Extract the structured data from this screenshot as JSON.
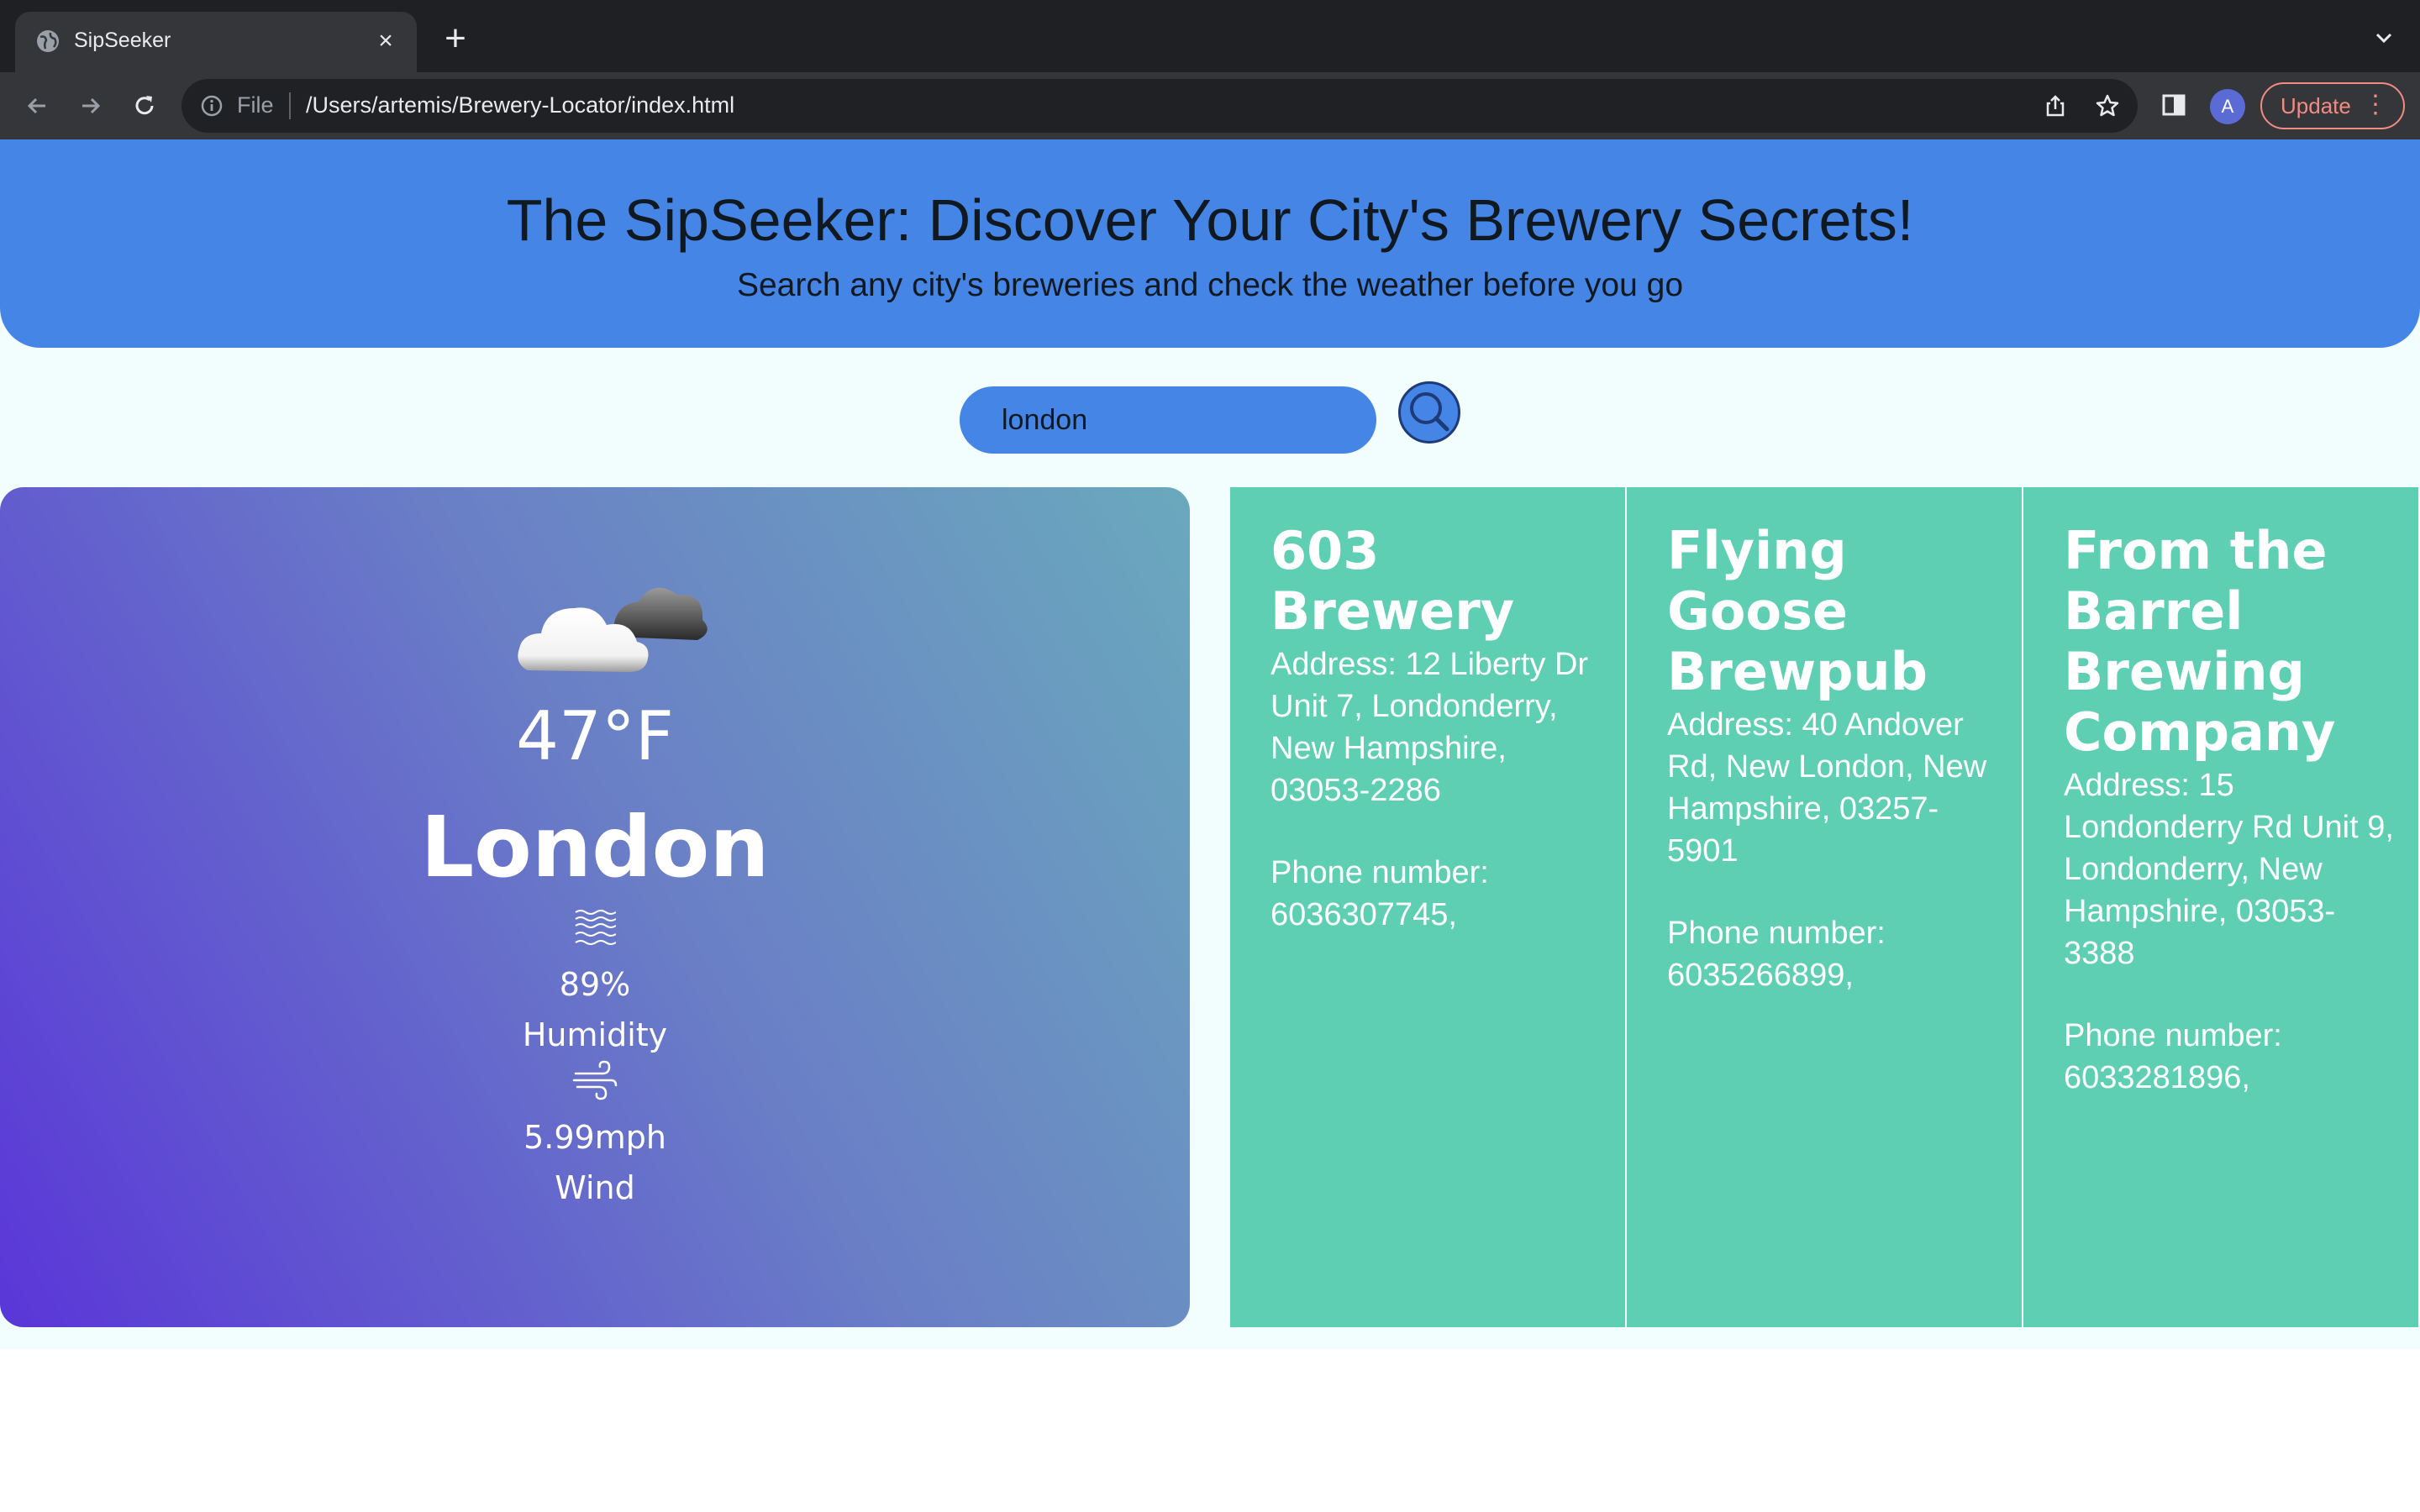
{
  "browser": {
    "tab_title": "SipSeeker",
    "url_scheme": "File",
    "url": "/Users/artemis/Brewery-Locator/index.html",
    "profile_initial": "A",
    "update_label": "Update"
  },
  "header": {
    "title": "The SipSeeker: Discover Your City's Brewery Secrets!",
    "subtitle": "Search any city's breweries and check the weather before you go"
  },
  "search": {
    "value": "london"
  },
  "weather": {
    "icon": "partly-cloudy-icon",
    "temperature": "47°F",
    "city": "London",
    "humidity_value": "89%",
    "humidity_label": "Humidity",
    "wind_value": "5.99mph",
    "wind_label": "Wind"
  },
  "breweries": [
    {
      "name": "603 Brewery",
      "address": "Address: 12 Liberty Dr Unit 7, Londonderry, New Hampshire, 03053-2286",
      "phone_label": "Phone number:",
      "phone": "6036307745,"
    },
    {
      "name": "Flying Goose Brewpub",
      "address": "Address: 40 Andover Rd, New London, New Hampshire, 03257-5901",
      "phone_label": "Phone number:",
      "phone": "6035266899,"
    },
    {
      "name": "From the Barrel Brewing Company",
      "address": "Address: 15 Londonderry Rd Unit 9, Londonderry, New Hampshire, 03053-3388",
      "phone_label": "Phone number:",
      "phone": "6033281896,"
    }
  ],
  "colors": {
    "header_blue": "#4585e6",
    "brewery_card": "#5fcfb3",
    "page_bg": "#f2fdfd"
  }
}
